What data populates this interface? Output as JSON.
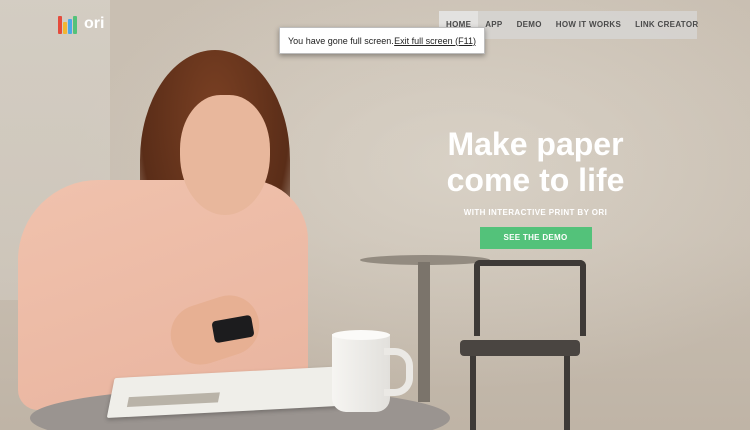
{
  "brand": {
    "name": "ori",
    "logo_icon": "ori-logo-icon"
  },
  "nav": {
    "items": [
      {
        "label": "HOME",
        "active": true
      },
      {
        "label": "APP",
        "active": false
      },
      {
        "label": "DEMO",
        "active": false
      },
      {
        "label": "HOW IT WORKS",
        "active": false
      },
      {
        "label": "LINK CREATOR",
        "active": false
      }
    ]
  },
  "fullscreen_notice": {
    "message": "You have gone full screen.",
    "exit_label": "Exit full screen (F11)"
  },
  "hero": {
    "title_line1": "Make paper",
    "title_line2": "come to life",
    "subtitle": "WITH INTERACTIVE PRINT BY ORI",
    "cta_label": "SEE THE DEMO"
  },
  "colors": {
    "accent_green": "#53c27a",
    "nav_bg": "#d6d4d0",
    "text_white": "#ffffff"
  }
}
